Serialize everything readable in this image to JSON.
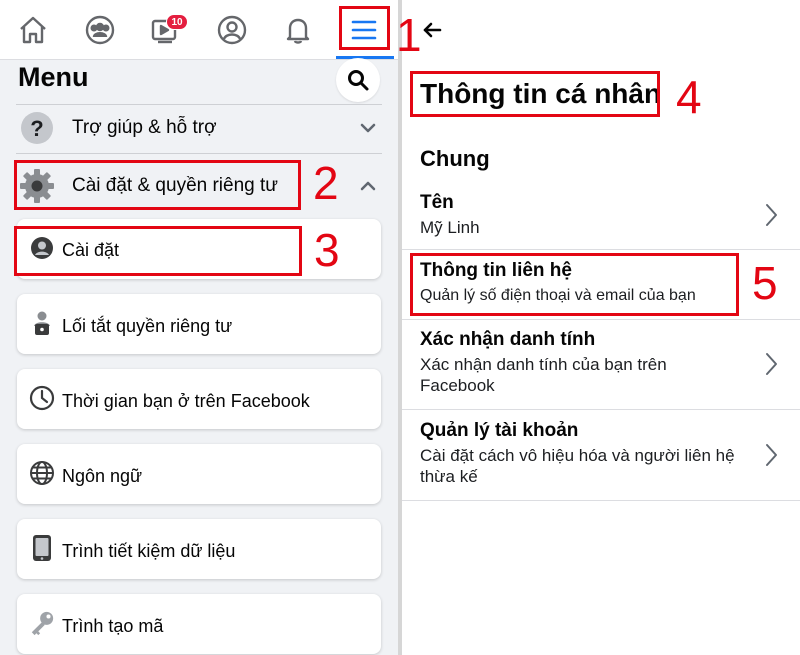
{
  "nav": {
    "notification_count": "10",
    "icons": [
      "home-icon",
      "groups-icon",
      "watch-icon",
      "profile-icon",
      "bell-icon",
      "hamburger-menu-icon"
    ]
  },
  "menu": {
    "title": "Menu",
    "sections": [
      {
        "label": "Trợ giúp & hỗ trợ",
        "icon": "help-icon",
        "expanded": false
      },
      {
        "label": "Cài đặt & quyền riêng tư",
        "icon": "gear-icon",
        "expanded": true
      }
    ],
    "items": [
      {
        "label": "Cài đặt",
        "icon": "user-circle-icon"
      },
      {
        "label": "Lối tắt quyền riêng tư",
        "icon": "lock-user-icon"
      },
      {
        "label": "Thời gian bạn ở trên Facebook",
        "icon": "clock-icon"
      },
      {
        "label": "Ngôn ngữ",
        "icon": "globe-icon"
      },
      {
        "label": "Trình tiết kiệm dữ liệu",
        "icon": "phone-icon"
      },
      {
        "label": "Trình tạo mã",
        "icon": "key-icon"
      }
    ]
  },
  "annotations": [
    "1",
    "2",
    "3",
    "4",
    "5"
  ],
  "details": {
    "title": "Thông tin cá nhân",
    "section": "Chung",
    "items": [
      {
        "title": "Tên",
        "subtitle": "Mỹ Linh"
      },
      {
        "title": "Thông tin liên hệ",
        "subtitle": "Quản lý số điện thoại và email của bạn"
      },
      {
        "title": "Xác nhận danh tính",
        "subtitle": "Xác nhận danh tính của bạn trên Facebook"
      },
      {
        "title": "Quản lý tài khoản",
        "subtitle": "Cài đặt cách vô hiệu hóa và người liên hệ thừa kế"
      }
    ]
  },
  "colors": {
    "annotation_red": "#e30613",
    "facebook_blue": "#1877f2",
    "badge_red": "#e41e3f",
    "panel_gray": "#f0f2f5"
  }
}
